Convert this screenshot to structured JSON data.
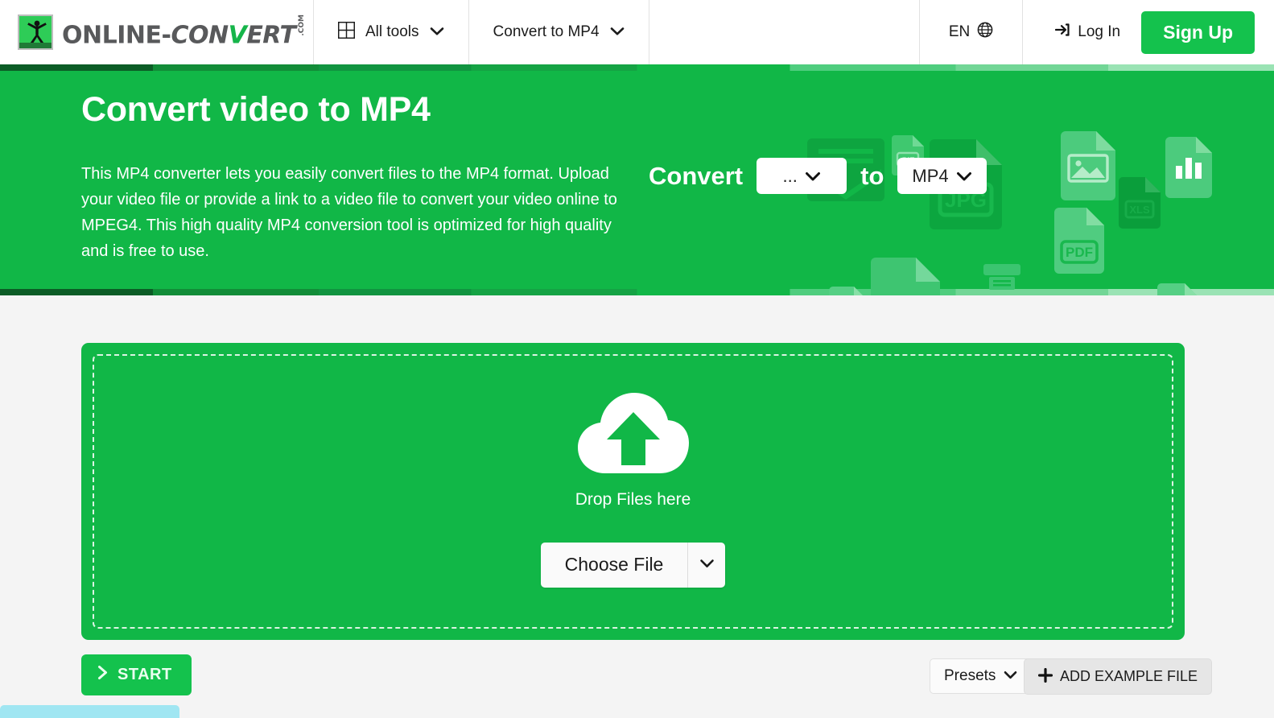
{
  "header": {
    "logo": {
      "name": "ONLINE-CONVERT",
      "part1": "ONLINE-",
      "part2": "CON",
      "part3": "V",
      "part4": "ERT",
      "dotcom": ".COM"
    },
    "nav": [
      {
        "label": "All tools",
        "icon": "grid-icon",
        "caret": "⌄"
      },
      {
        "label": "Convert to MP4",
        "icon": null,
        "caret": "⌄"
      }
    ],
    "language": {
      "label": "EN",
      "icon": "globe-icon"
    },
    "login": {
      "label": "Log In",
      "icon": "login-arrow-icon"
    },
    "signup": {
      "label": "Sign Up"
    }
  },
  "hero": {
    "title": "Convert video to MP4",
    "description": "This MP4 converter lets you easily convert files to the MP4 format. Upload your video file or provide a link to a video file to convert your video online to MPEG4. This high quality MP4 conversion tool is optimized for high quality and is free to use.",
    "convert_label": "Convert",
    "to_label": "to",
    "source_format": "...",
    "target_format": "MP4",
    "background_icons": [
      "envelope-icon",
      "gif-file-icon",
      "jpg-file-icon",
      "image-file-icon",
      "chart-file-icon",
      "xls-file-icon",
      "pdf-file-icon",
      "png-file-icon",
      "printer-icon",
      "docx-file-icon",
      "txt-file-icon",
      "font-file-icon",
      "graph-file-icon"
    ]
  },
  "main": {
    "drop_text": "Drop Files here",
    "choose_file_label": "Choose File",
    "choose_file_caret": "⌄",
    "upload_icon": "cloud-upload-icon"
  },
  "actions": {
    "start_label": "START",
    "start_icon": "chevron-right-icon",
    "presets_label": "Presets",
    "presets_caret": "⌄",
    "add_example_label": "ADD EXAMPLE FILE",
    "add_example_icon": "plus-icon"
  },
  "colors": {
    "brand_green": "#11b747",
    "button_green": "#14c24d",
    "page_bg": "#f4f4f4",
    "header_bg": "#ffffff",
    "text_dark": "#1b1b1b",
    "cookie_bar": "#a0e6f2"
  }
}
